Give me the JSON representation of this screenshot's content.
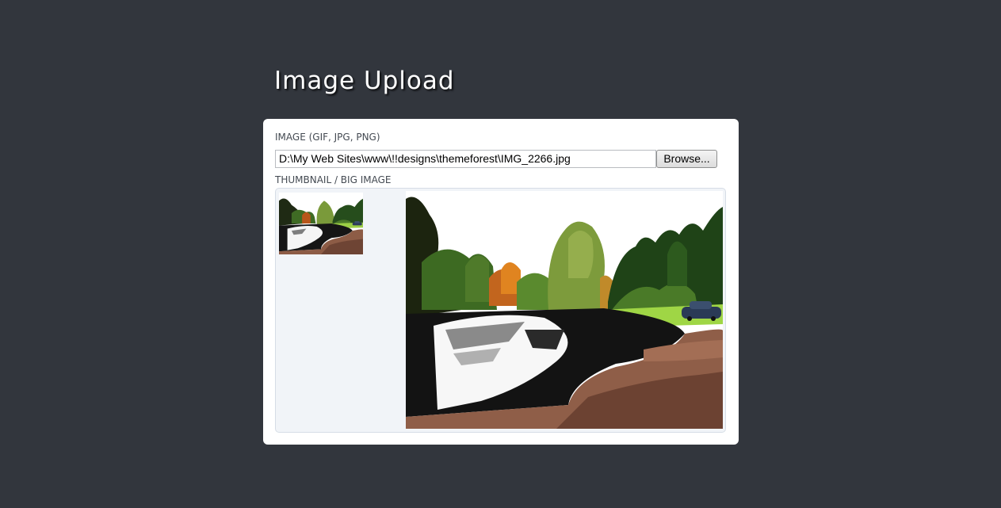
{
  "page": {
    "title": "Image Upload"
  },
  "upload_form": {
    "image_label": "IMAGE (GIF, JPG, PNG)",
    "file_path": "D:\\My Web Sites\\www\\!!designs\\themeforest\\IMG_2266.jpg",
    "browse_label": "Browse...",
    "preview_label": "THUMBNAIL / BIG IMAGE"
  },
  "colors": {
    "background": "#32363d",
    "panel": "#ffffff",
    "preview_bg": "#f1f4f8"
  },
  "icons": {
    "thumbnail": "lake-landscape-photo",
    "big_image": "lake-landscape-photo"
  }
}
